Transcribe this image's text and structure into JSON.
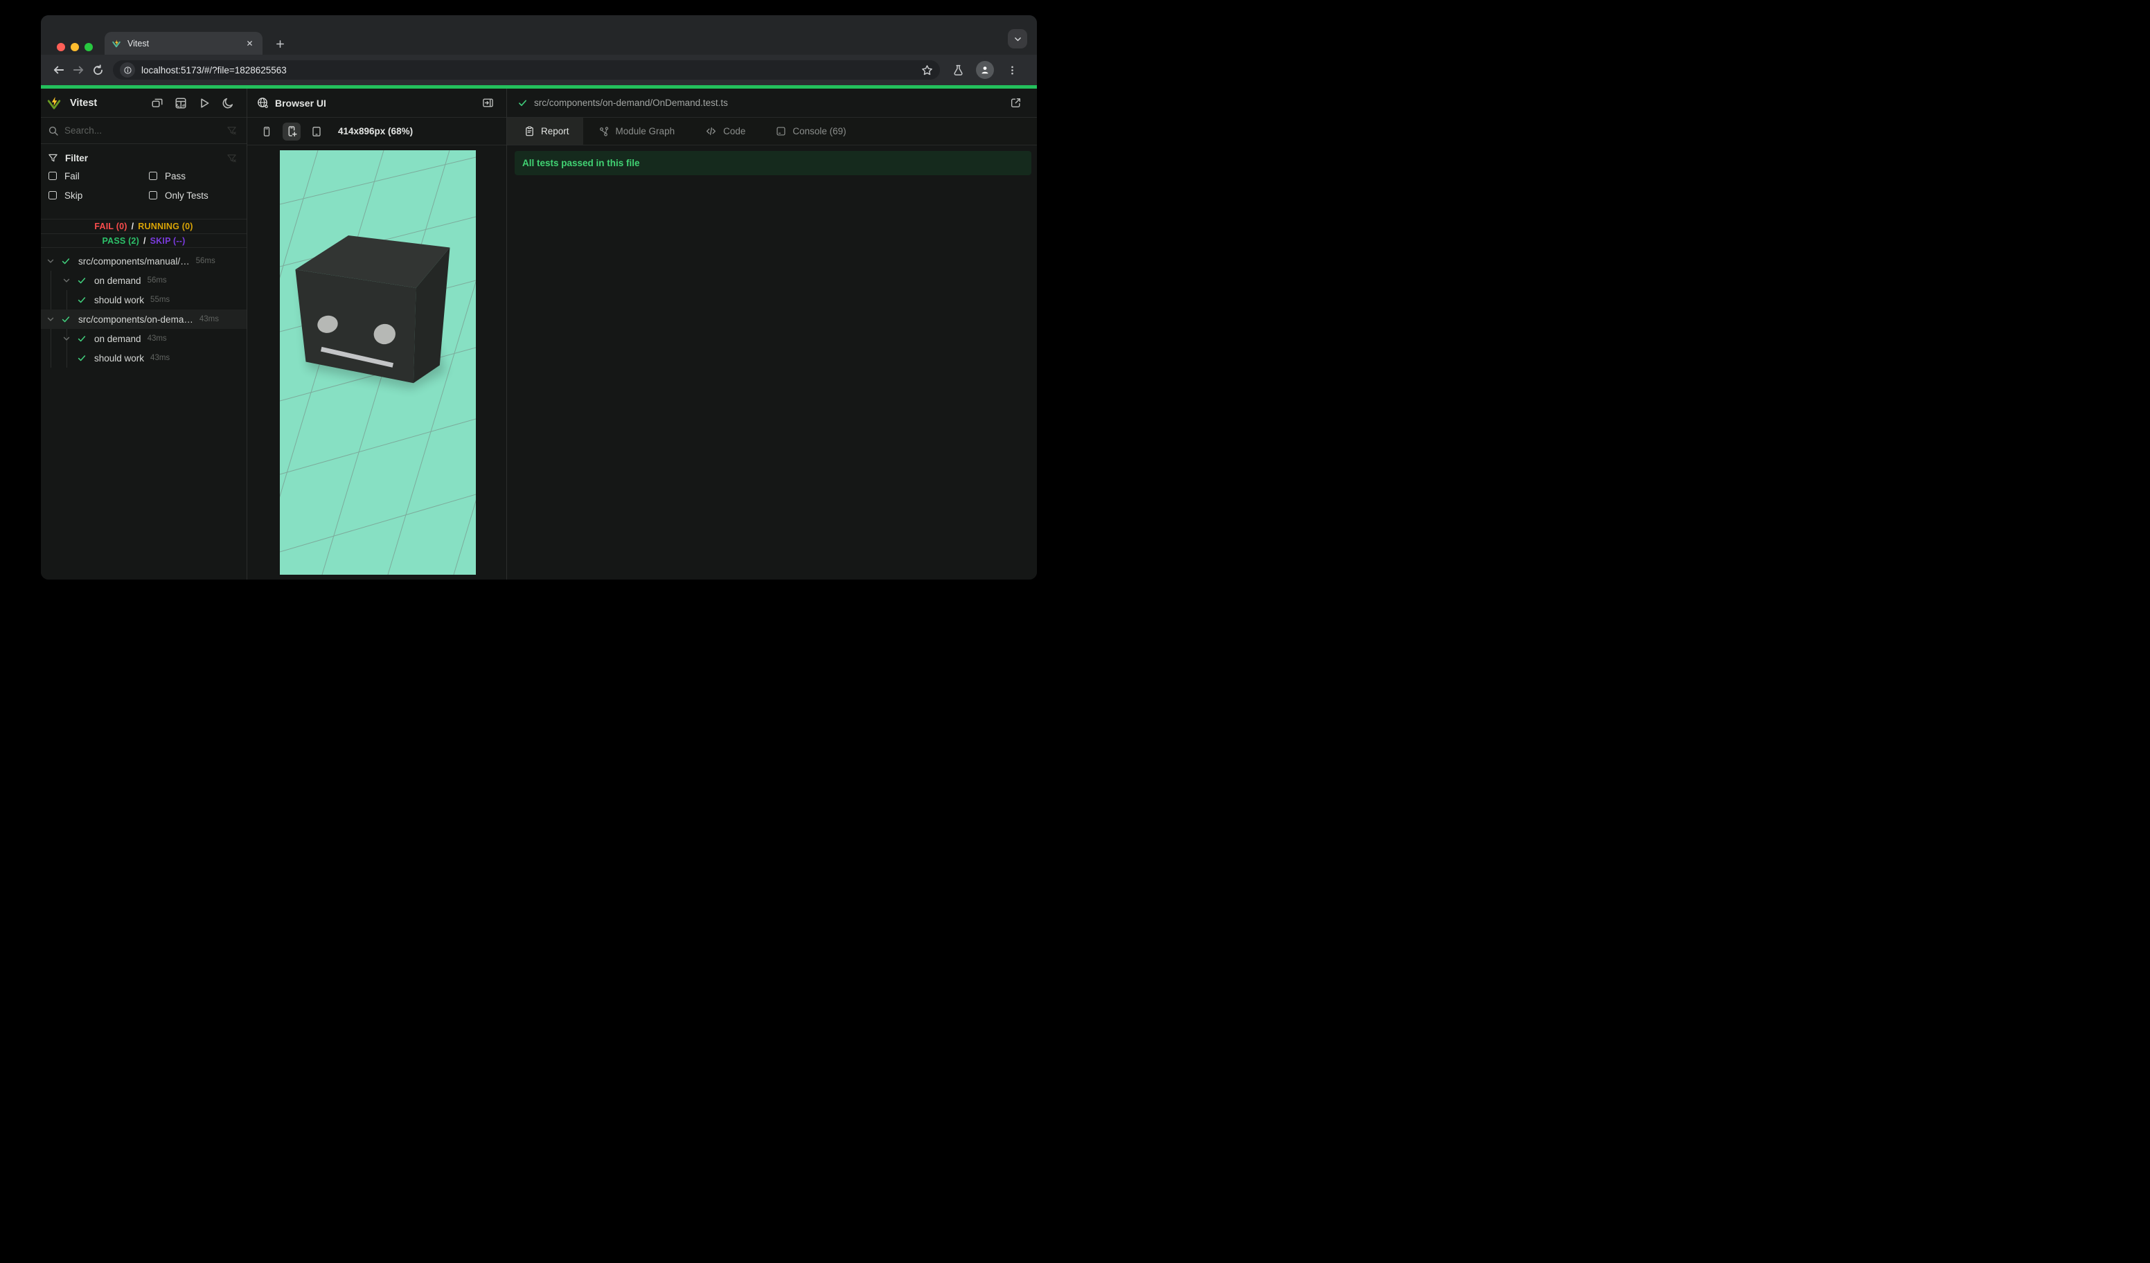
{
  "chrome": {
    "tab_title": "Vitest",
    "url": "localhost:5173/#/?file=1828625563"
  },
  "sidebar": {
    "title": "Vitest",
    "search_placeholder": "Search...",
    "filter": {
      "title": "Filter",
      "options": [
        "Fail",
        "Pass",
        "Skip",
        "Only Tests"
      ]
    },
    "status": {
      "fail_label": "FAIL (0)",
      "running_label": "RUNNING (0)",
      "pass_label": "PASS (2)",
      "skip_label": "SKIP (--)",
      "separator": "/"
    },
    "tree": [
      {
        "type": "file",
        "label": "src/components/manual/…",
        "duration": "56ms"
      },
      {
        "type": "suite",
        "label": "on demand",
        "duration": "56ms"
      },
      {
        "type": "test",
        "label": "should work",
        "duration": "55ms"
      },
      {
        "type": "file",
        "label": "src/components/on-dema…",
        "duration": "43ms",
        "selected": true
      },
      {
        "type": "suite",
        "label": "on demand",
        "duration": "43ms"
      },
      {
        "type": "test",
        "label": "should work",
        "duration": "43ms"
      }
    ]
  },
  "browser_panel": {
    "title": "Browser UI",
    "dimensions": "414x896px (68%)"
  },
  "report_panel": {
    "file_path": "src/components/on-demand/OnDemand.test.ts",
    "tabs": [
      {
        "label": "Report",
        "active": true
      },
      {
        "label": "Module Graph"
      },
      {
        "label": "Code"
      },
      {
        "label": "Console (69)"
      }
    ],
    "banner": "All tests passed in this file"
  },
  "colors": {
    "progress_green": "#23c05c",
    "pass_green": "#2cc169",
    "fail_red": "#fb4d4d",
    "running_yellow": "#d9a406",
    "skip_purple": "#7a3bdd",
    "banner_bg": "#152a1d",
    "banner_text": "#41d273",
    "viewport_mint": "#87e0c3",
    "logo_yellow": "#fcc72b",
    "logo_green": "#699b23"
  }
}
